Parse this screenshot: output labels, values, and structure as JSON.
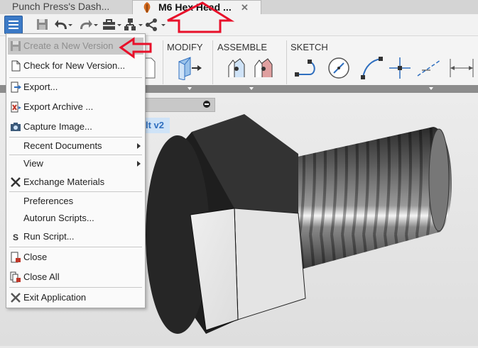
{
  "tabs": [
    {
      "label": "Punch Press's Dash..."
    },
    {
      "label": "M6 Hex Head ...",
      "close": "✕"
    }
  ],
  "quick_access": {
    "icons": [
      "menu-icon",
      "save-icon",
      "undo-icon",
      "redo-icon",
      "toolbox-icon",
      "hierarchy-icon",
      "share-icon"
    ]
  },
  "ribbon": {
    "groups": [
      {
        "label": "MODIFY"
      },
      {
        "label": "ASSEMBLE"
      },
      {
        "label": "SKETCH"
      }
    ]
  },
  "browser": {
    "document_label": "lt v2"
  },
  "file_menu": {
    "items": [
      {
        "label": "Create a New Version",
        "state": "disabled",
        "icon": "save-icon"
      },
      {
        "label": "Check for New Version...",
        "icon": "document-icon"
      },
      {
        "label": "Export...",
        "icon": "export-icon"
      },
      {
        "label": "Export Archive ...",
        "icon": "export-archive-icon"
      },
      {
        "label": "Capture Image...",
        "icon": "camera-icon"
      },
      {
        "label": "Recent Documents",
        "submenu": true
      },
      {
        "label": "View",
        "submenu": true
      },
      {
        "label": "Exchange Materials",
        "icon": "exchange-icon"
      },
      {
        "label": "Preferences"
      },
      {
        "label": "Autorun Scripts..."
      },
      {
        "label": "Run Script...",
        "icon": "script-icon"
      },
      {
        "label": "Close",
        "icon": "close-doc-icon"
      },
      {
        "label": "Close All",
        "icon": "close-all-icon"
      },
      {
        "label": "Exit Application",
        "icon": "exit-icon"
      }
    ]
  },
  "colors": {
    "menu_button": "#3c7ac6",
    "annotation_arrow": "#e8102a",
    "selection": "#cfe3f7"
  }
}
